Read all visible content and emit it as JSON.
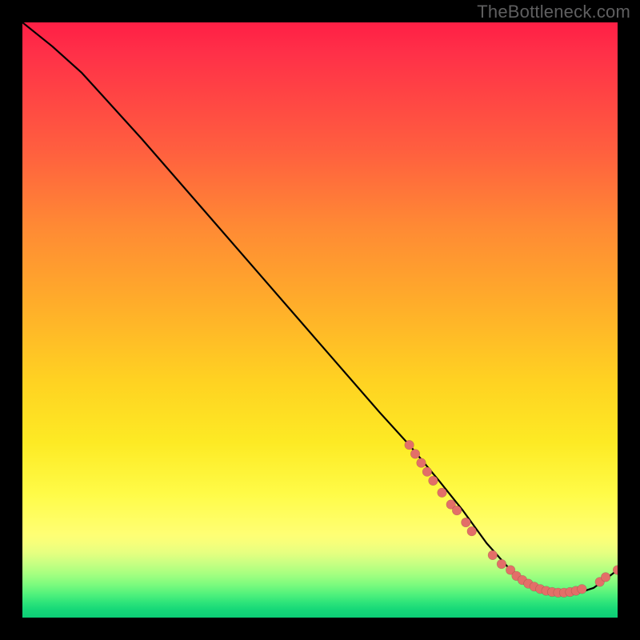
{
  "watermark": "TheBottleneck.com",
  "chart_data": {
    "type": "line",
    "title": "",
    "xlabel": "",
    "ylabel": "",
    "ylim": [
      0,
      100
    ],
    "xlim": [
      0,
      100
    ],
    "background": "rainbow-gradient",
    "series": [
      {
        "name": "curve",
        "x": [
          0,
          5,
          10,
          20,
          30,
          40,
          50,
          60,
          65,
          70,
          74,
          78,
          82,
          86,
          90,
          93,
          96,
          100
        ],
        "y": [
          100,
          96,
          91.5,
          80.5,
          69,
          57.5,
          46,
          34.5,
          29,
          23,
          18,
          12.5,
          8,
          5,
          4,
          4,
          5,
          8
        ]
      }
    ],
    "points": [
      {
        "x": 65,
        "y": 29
      },
      {
        "x": 66,
        "y": 27.5
      },
      {
        "x": 67,
        "y": 26
      },
      {
        "x": 68,
        "y": 24.5
      },
      {
        "x": 69,
        "y": 23
      },
      {
        "x": 70.5,
        "y": 21
      },
      {
        "x": 72,
        "y": 19
      },
      {
        "x": 73,
        "y": 18
      },
      {
        "x": 74.5,
        "y": 16
      },
      {
        "x": 75.5,
        "y": 14.5
      },
      {
        "x": 79,
        "y": 10.5
      },
      {
        "x": 80.5,
        "y": 9
      },
      {
        "x": 82,
        "y": 8
      },
      {
        "x": 83,
        "y": 7
      },
      {
        "x": 84,
        "y": 6.3
      },
      {
        "x": 85,
        "y": 5.7
      },
      {
        "x": 86,
        "y": 5.2
      },
      {
        "x": 87,
        "y": 4.8
      },
      {
        "x": 88,
        "y": 4.5
      },
      {
        "x": 89,
        "y": 4.3
      },
      {
        "x": 90,
        "y": 4.2
      },
      {
        "x": 91,
        "y": 4.2
      },
      {
        "x": 92,
        "y": 4.3
      },
      {
        "x": 93,
        "y": 4.5
      },
      {
        "x": 94,
        "y": 4.8
      },
      {
        "x": 97,
        "y": 6
      },
      {
        "x": 98,
        "y": 6.8
      },
      {
        "x": 100,
        "y": 8
      }
    ],
    "colors": {
      "line": "#000000",
      "points": "#e36f68",
      "gradient_top": "#ff1f45",
      "gradient_mid": "#fffb47",
      "gradient_bottom": "#0cce76"
    }
  }
}
